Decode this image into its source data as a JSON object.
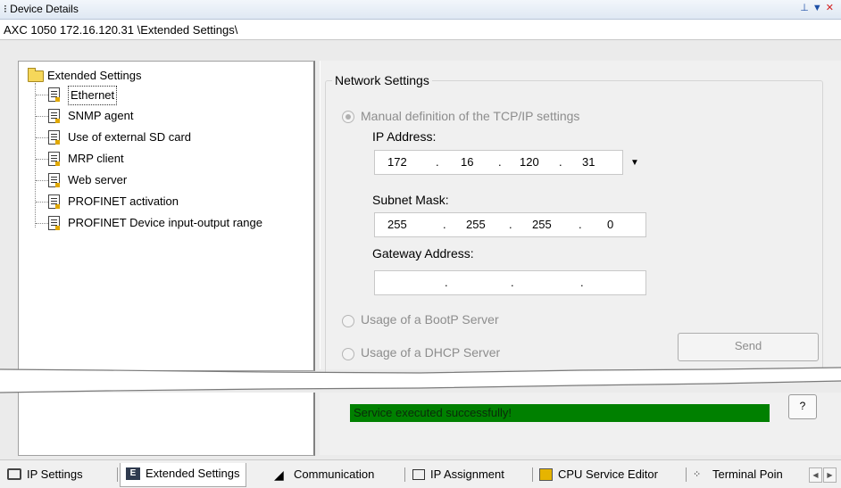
{
  "window": {
    "title": "Device Details",
    "path": "AXC 1050 172.16.120.31 \\Extended Settings\\"
  },
  "tree": {
    "root": "Extended Settings",
    "items": [
      {
        "label": "Ethernet",
        "selected": true
      },
      {
        "label": "SNMP agent"
      },
      {
        "label": "Use of external SD card"
      },
      {
        "label": "MRP client"
      },
      {
        "label": "Web server"
      },
      {
        "label": "PROFINET activation"
      },
      {
        "label": "PROFINET Device input-output range"
      }
    ]
  },
  "network": {
    "group_title": "Network Settings",
    "manual_label": "Manual definition of the TCP/IP settings",
    "ip_label": "IP Address:",
    "ip": [
      "172",
      "16",
      "120",
      "31"
    ],
    "subnet_label": "Subnet Mask:",
    "subnet": [
      "255",
      "255",
      "255",
      "0"
    ],
    "gateway_label": "Gateway Address:",
    "gateway": [
      "",
      "",
      "",
      ""
    ],
    "bootp_label": "Usage of a BootP Server",
    "dhcp_label": "Usage of a DHCP Server",
    "send_label": "Send"
  },
  "status": {
    "message": "Service executed successfully!",
    "help_label": "?",
    "color": "#008000"
  },
  "tabs": [
    {
      "label": "IP Settings",
      "icon": "network-plug-icon"
    },
    {
      "label": "Extended Settings",
      "icon": "extended-settings-icon",
      "active": true
    },
    {
      "label": "Communication",
      "icon": "communication-icon"
    },
    {
      "label": "IP Assignment",
      "icon": "ip-assignment-icon"
    },
    {
      "label": "CPU Service Editor",
      "icon": "cpu-service-icon"
    },
    {
      "label": "Terminal Poin",
      "icon": "terminal-points-icon"
    }
  ]
}
